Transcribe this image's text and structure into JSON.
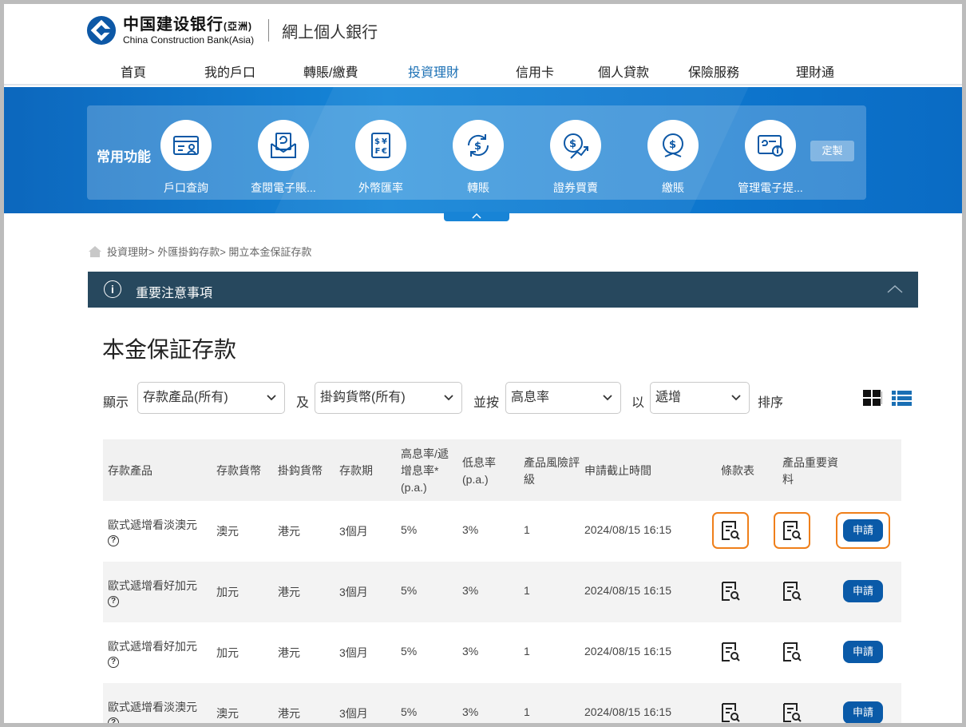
{
  "header": {
    "bank_cn": "中国建设银行",
    "bank_cn_suffix": "(亞洲)",
    "bank_en": "China Construction Bank(Asia)",
    "site_name": "網上個人銀行"
  },
  "nav": [
    "首頁",
    "我的戶口",
    "轉賬/繳費",
    "投資理財",
    "信用卡",
    "個人貸款",
    "保險服務",
    "理財通"
  ],
  "nav_active": "投資理財",
  "quick": {
    "title": "常用功能",
    "items": [
      "戶口查詢",
      "查閱電子賬...",
      "外幣匯率",
      "轉賬",
      "證券買賣",
      "繳賬",
      "管理電子提..."
    ],
    "custom_label": "定製"
  },
  "breadcrumb": "投資理財> 外匯掛鈎存款> 開立本金保証存款",
  "notice": "重要注意事項",
  "page_title": "本金保証存款",
  "filters": {
    "show_label": "顯示",
    "product": "存款產品(所有)",
    "and_label": "及",
    "currency": "掛鈎貨幣(所有)",
    "sort_by_label": "並按",
    "sort_field": "高息率",
    "with_label": "以",
    "sort_order": "遞增",
    "sort_label": "排序"
  },
  "table": {
    "headers": [
      "存款產品",
      "存款貨幣",
      "掛鈎貨幣",
      "存款期",
      "高息率/遞增息率*\n(p.a.)",
      "低息率\n(p.a.)",
      "產品風險評級",
      "申請截止時間",
      "條款表",
      "產品重要資料"
    ],
    "apply_label": "申請",
    "help_symbol": "?",
    "rows": [
      {
        "product": "歐式遞增看淡澳元",
        "dep_ccy": "澳元",
        "link_ccy": "港元",
        "term": "3個月",
        "high": "5%",
        "low": "3%",
        "risk": "1",
        "deadline": "2024/08/15 16:15"
      },
      {
        "product": "歐式遞增看好加元",
        "dep_ccy": "加元",
        "link_ccy": "港元",
        "term": "3個月",
        "high": "5%",
        "low": "3%",
        "risk": "1",
        "deadline": "2024/08/15 16:15"
      },
      {
        "product": "歐式遞增看好加元",
        "dep_ccy": "加元",
        "link_ccy": "港元",
        "term": "3個月",
        "high": "5%",
        "low": "3%",
        "risk": "1",
        "deadline": "2024/08/15 16:15"
      },
      {
        "product": "歐式遞增看淡澳元",
        "dep_ccy": "澳元",
        "link_ccy": "港元",
        "term": "3個月",
        "high": "5%",
        "low": "3%",
        "risk": "1",
        "deadline": "2024/08/15 16:15"
      }
    ]
  },
  "colors": {
    "accent_blue": "#1a6fb4",
    "notice_bg": "#27485e",
    "highlight": "#ef7f1a",
    "apply_bg": "#0a5aa8"
  }
}
